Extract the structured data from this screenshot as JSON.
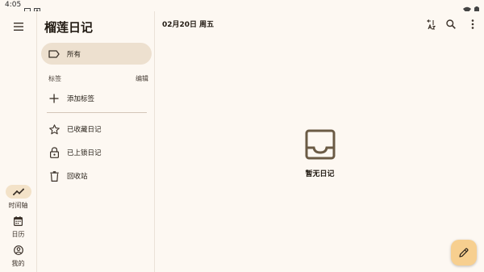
{
  "status_bar": {
    "time": "4:05"
  },
  "app": {
    "title": "榴莲日记"
  },
  "rail": {
    "items": [
      {
        "label": "时间轴",
        "icon": "timeline-icon",
        "active": true
      },
      {
        "label": "日历",
        "icon": "calendar-icon",
        "active": false
      },
      {
        "label": "我的",
        "icon": "account-icon",
        "active": false
      }
    ]
  },
  "drawer": {
    "all_label": "所有",
    "tags_header": "标签",
    "edit_label": "编辑",
    "add_tag_label": "添加标签",
    "starred_label": "已收藏日记",
    "locked_label": "已上锁日记",
    "trash_label": "回收站"
  },
  "main": {
    "date": "02月20日 周五",
    "empty_text": "暂无日记"
  },
  "colors": {
    "background": "#fdf8f2",
    "active_pill": "#ede0cf",
    "fab": "#f7cf8f",
    "text": "#221b13"
  }
}
